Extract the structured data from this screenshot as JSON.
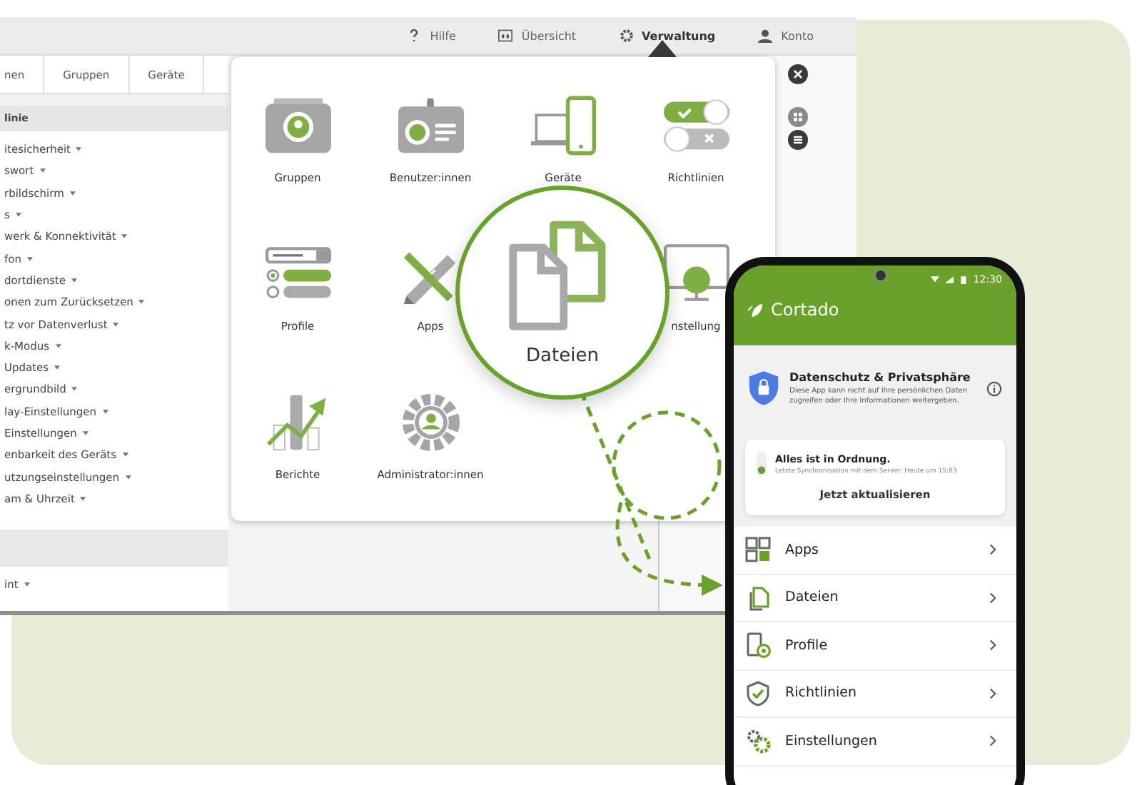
{
  "top_bar": {
    "items": [
      {
        "label": "Hilfe",
        "kind": "help",
        "selected": false
      },
      {
        "label": "Übersicht",
        "kind": "overview",
        "selected": false
      },
      {
        "label": "Verwaltung",
        "kind": "gear",
        "selected": true
      },
      {
        "label": "Konto",
        "kind": "user",
        "selected": false
      }
    ]
  },
  "admin_tabs": [
    {
      "label": "nen",
      "selected": false
    },
    {
      "label": "Gruppen",
      "selected": false
    },
    {
      "label": "Geräte",
      "selected": false
    }
  ],
  "policy_list": {
    "header": "linie",
    "items": [
      "itesicherheit",
      "swort",
      "rbildschirm",
      "s",
      "werk & Konnektivität",
      "fon",
      "dortdienste",
      "onen zum Zurücksetzen",
      "tz vor Datenverlust",
      "k-Modus",
      "Updates",
      "ergrundbild",
      "lay-Einstellungen",
      "Einstellungen",
      "enbarkeit des Geräts",
      "utzungseinstellungen",
      "am & Uhrzeit"
    ]
  },
  "lower_list": {
    "items": [
      "int"
    ]
  },
  "menu_tiles": [
    {
      "label": "Gruppen",
      "kind": "groups"
    },
    {
      "label": "Benutzer:innen",
      "kind": "badge"
    },
    {
      "label": "Geräte",
      "kind": "devices"
    },
    {
      "label": "Richtlinien",
      "kind": "toggles"
    },
    {
      "label": "Profile",
      "kind": "form"
    },
    {
      "label": "Apps",
      "kind": "tools"
    },
    {
      "label": "nstellung",
      "kind": "monitor"
    },
    {
      "label": "Berichte",
      "kind": "chart"
    },
    {
      "label": "Administrator:innen",
      "kind": "admin"
    }
  ],
  "magnifier": {
    "label": "Dateien"
  },
  "phone": {
    "time": "12:30",
    "app_title": "Cortado",
    "privacy_card": {
      "title": "Datenschutz & Privatsphäre",
      "text": "Diese App kann nicht auf Ihre persönlichen Daten zugreifen oder Ihre Informationen weitergeben."
    },
    "status_card": {
      "title": "Alles ist in Ordnung.",
      "text": "Letzte Synchronisation mit dem Server: Heute um 15:03",
      "button": "Jetzt aktualisieren"
    },
    "menu": [
      {
        "label": "Apps",
        "kind": "apps"
      },
      {
        "label": "Dateien",
        "kind": "files"
      },
      {
        "label": "Profile",
        "kind": "profile"
      },
      {
        "label": "Richtlinien",
        "kind": "shield"
      },
      {
        "label": "Einstellungen",
        "kind": "gears"
      }
    ]
  }
}
